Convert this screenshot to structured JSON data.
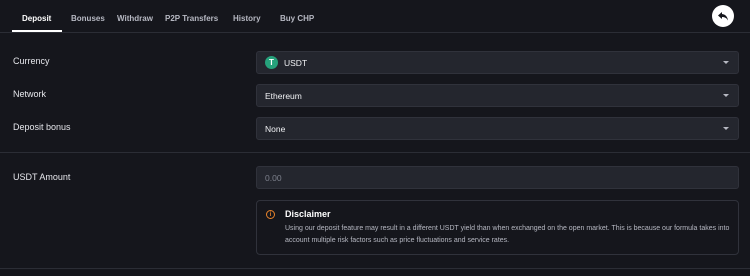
{
  "tabs": [
    {
      "label": "Deposit",
      "active": true
    },
    {
      "label": "Bonuses",
      "active": false
    },
    {
      "label": "Withdraw",
      "active": false
    },
    {
      "label": "P2P Transfers",
      "active": false
    },
    {
      "label": "History",
      "active": false
    },
    {
      "label": "Buy CHP",
      "active": false
    }
  ],
  "back_button": {
    "icon": "reply-arrow-icon"
  },
  "fields": {
    "currency": {
      "label": "Currency",
      "value": "USDT",
      "icon": "tether-icon",
      "icon_color": "#26a17b",
      "icon_glyph": "T"
    },
    "network": {
      "label": "Network",
      "value": "Ethereum"
    },
    "deposit_bonus": {
      "label": "Deposit bonus",
      "value": "None"
    }
  },
  "amount": {
    "label": "USDT Amount",
    "placeholder": "0.00"
  },
  "disclaimer": {
    "title": "Disclaimer",
    "body": "Using our deposit feature may result in a different USDT yield than when exchanged on the open market. This is because our formula takes into account multiple risk factors such as price fluctuations and service rates.",
    "icon": "info-icon",
    "icon_glyph": "i",
    "accent_color": "#e8832b"
  },
  "colors": {
    "background": "#15161c",
    "field": "#24262e",
    "accent": "#e8832b"
  }
}
